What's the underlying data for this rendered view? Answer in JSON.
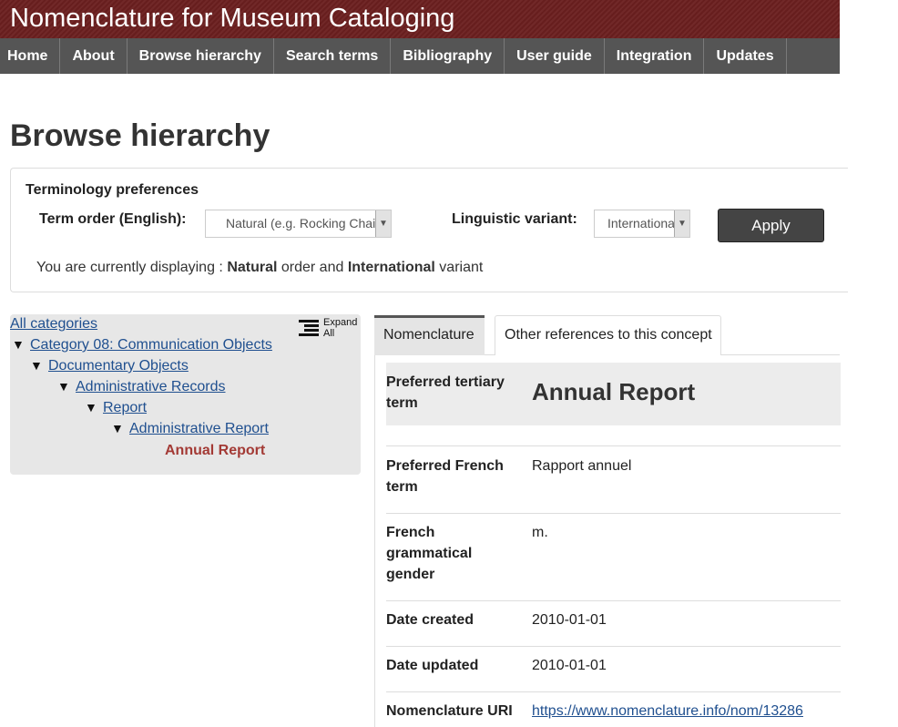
{
  "site": {
    "title": "Nomenclature for Museum Cataloging"
  },
  "nav": [
    "Home",
    "About",
    "Browse hierarchy",
    "Search terms",
    "Bibliography",
    "User guide",
    "Integration",
    "Updates"
  ],
  "page": {
    "title": "Browse hierarchy"
  },
  "prefs": {
    "heading": "Terminology preferences",
    "term_order_label": "Term order (English):",
    "term_order_value": "Natural (e.g. Rocking Chair)",
    "variant_label": "Linguistic variant:",
    "variant_value": "International",
    "apply_label": "Apply",
    "status_prefix": "You are currently displaying : ",
    "status_order": "Natural",
    "status_middle": " order and ",
    "status_variant": "International",
    "status_suffix": " variant"
  },
  "tree": {
    "expand_all_line1": "Expand",
    "expand_all_line2": "All",
    "all_categories": "All categories",
    "levels": [
      "Category 08: Communication Objects",
      "Documentary Objects",
      "Administrative Records",
      "Report",
      "Administrative Report"
    ],
    "current": "Annual Report"
  },
  "tabs": {
    "active": "Nomenclature",
    "other": "Other references to this concept"
  },
  "details": [
    {
      "key": "Preferred tertiary term",
      "value": "Annual Report"
    },
    {
      "key": "Preferred French term",
      "value": "Rapport annuel"
    },
    {
      "key": "French grammatical gender",
      "value": "m."
    },
    {
      "key": "Date created",
      "value": "2010-01-01"
    },
    {
      "key": "Date updated",
      "value": "2010-01-01"
    },
    {
      "key": "Nomenclature URI",
      "value": "https://www.nomenclature.info/nom/13286"
    }
  ],
  "icons": {
    "dropdown_arrow": "chevron-down-icon",
    "tree_expanded": "triangle-down-icon",
    "expand_all": "list-expand-icon"
  }
}
